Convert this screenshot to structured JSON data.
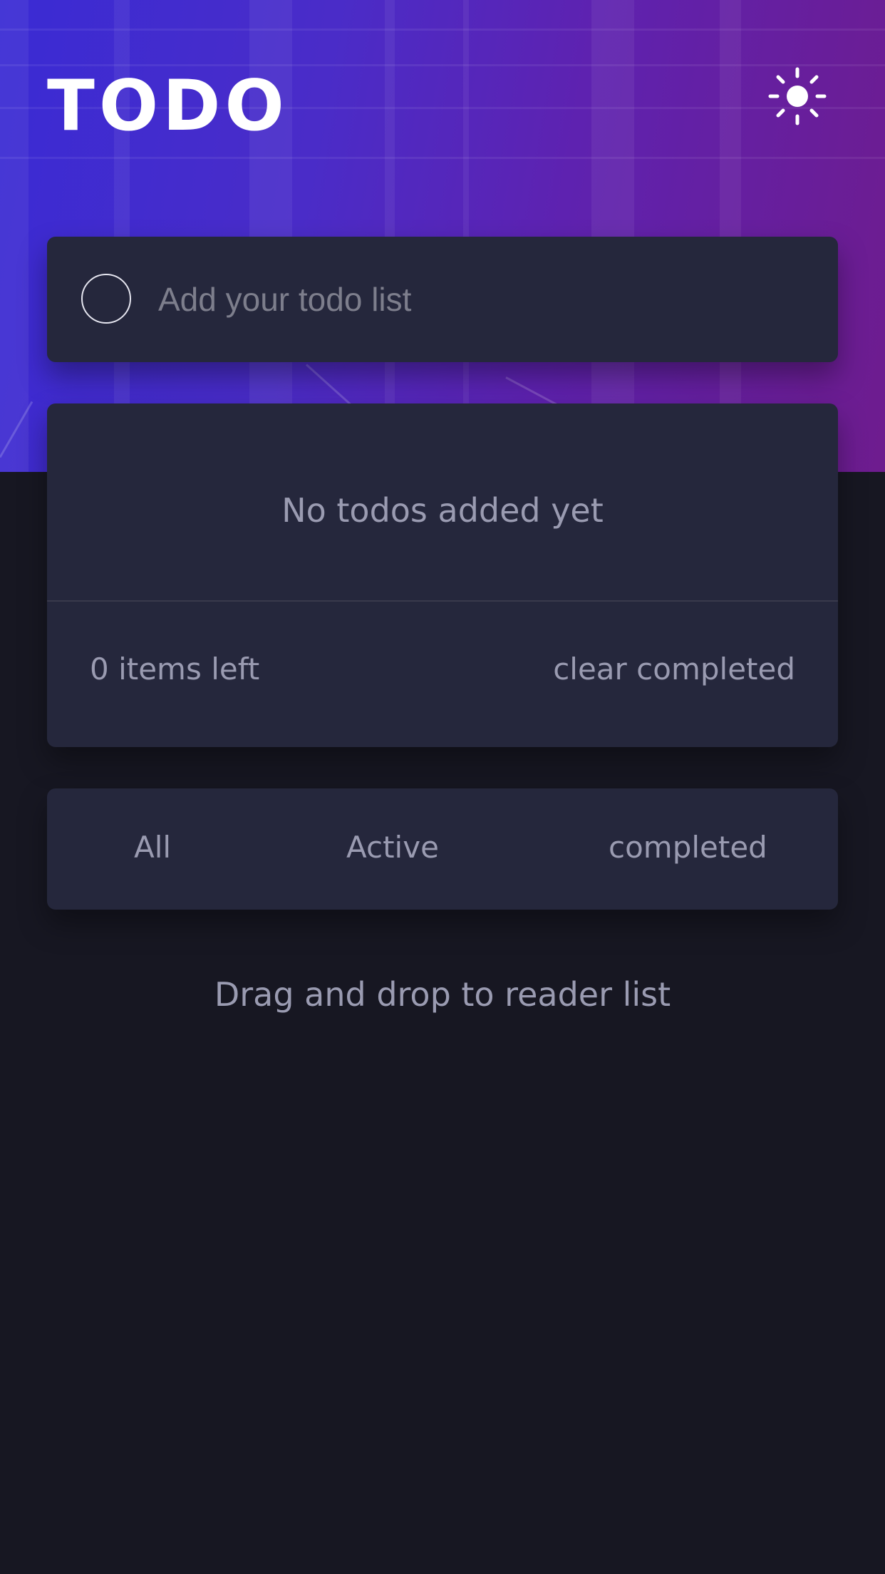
{
  "header": {
    "title": "TODO",
    "theme_icon": "sun-icon"
  },
  "new_todo": {
    "placeholder": "Add your todo list",
    "value": ""
  },
  "list": {
    "empty_message": "No todos added yet",
    "items_left": "0 items left",
    "clear_label": "clear completed"
  },
  "filters": {
    "all": "All",
    "active": "Active",
    "completed": "completed"
  },
  "hint": "Drag and drop to reader list",
  "colors": {
    "background": "#171722",
    "card": "#25273c",
    "muted_text": "#9a9bb1",
    "hero_start": "#3a2bd4",
    "hero_end": "#6e1c8e"
  }
}
